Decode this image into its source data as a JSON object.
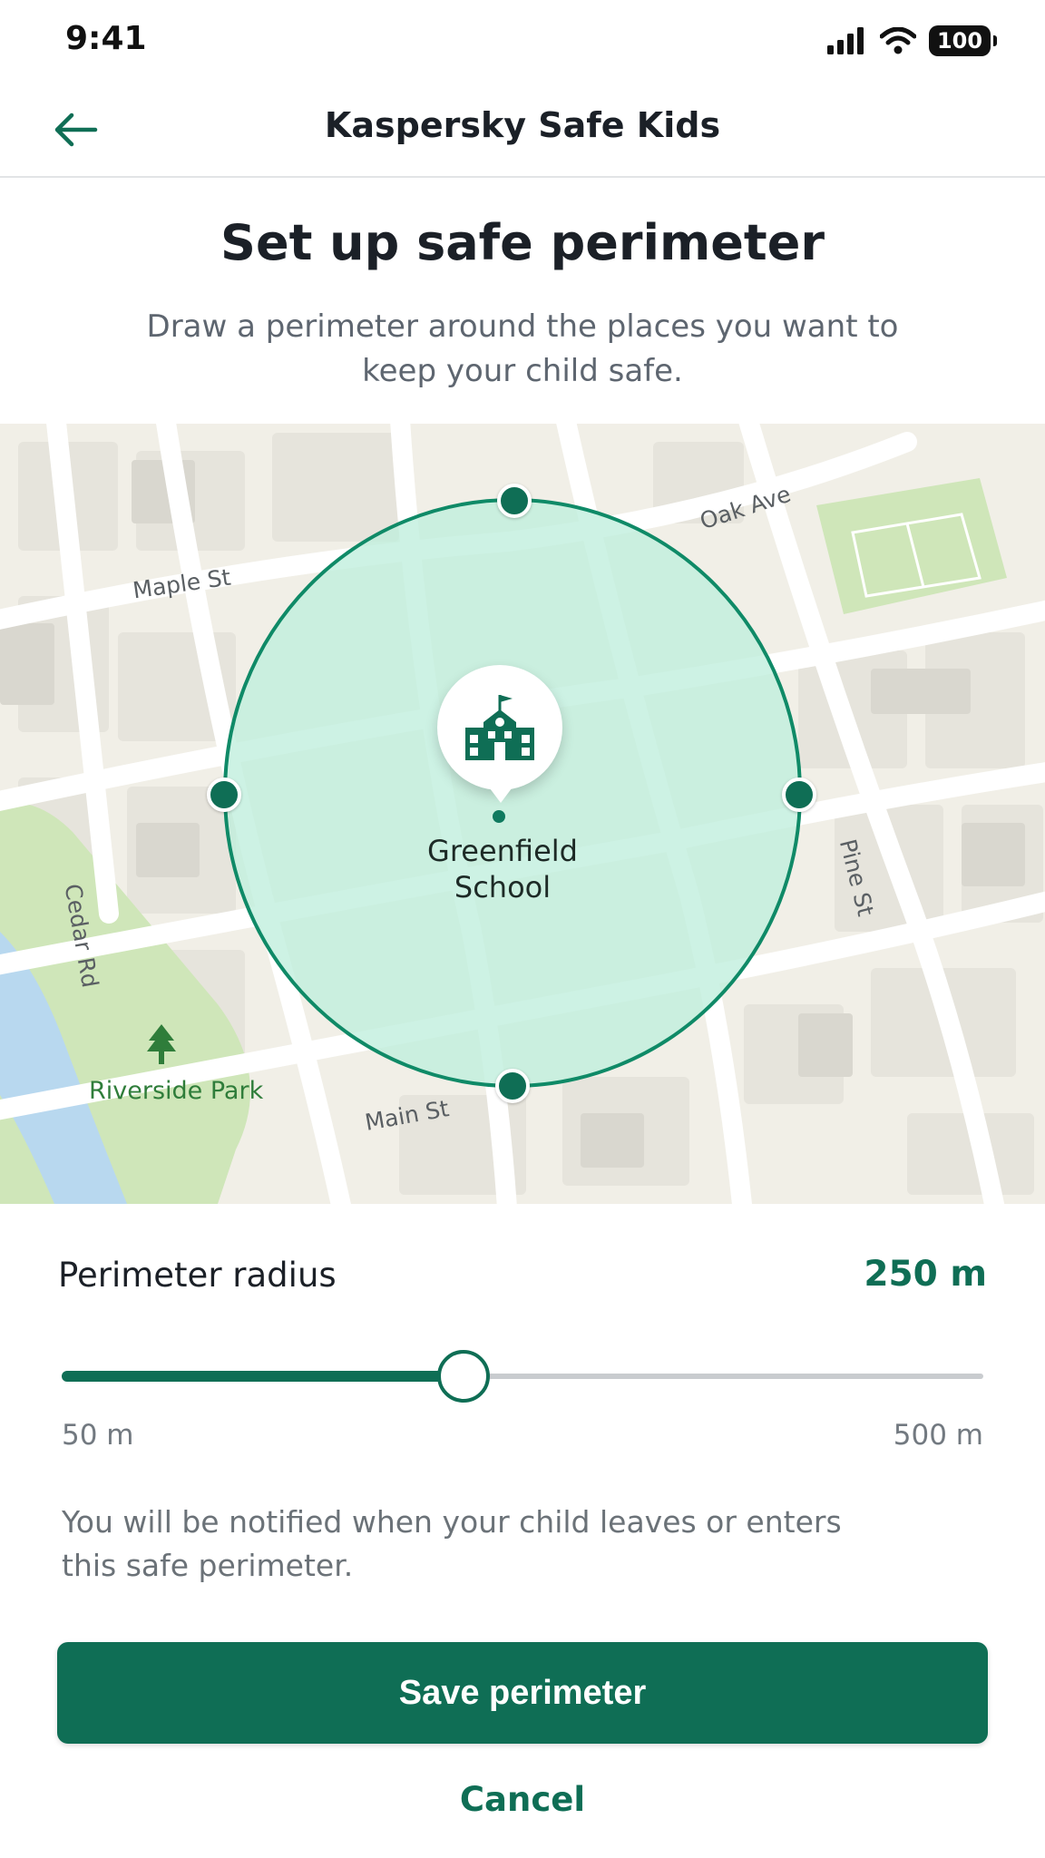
{
  "status_bar": {
    "time": "9:41",
    "battery": "100",
    "icons": [
      "signal-icon",
      "wifi-icon",
      "battery-icon"
    ]
  },
  "nav": {
    "title": "Kaspersky Safe Kids",
    "back_icon": "arrow-left-icon"
  },
  "header": {
    "title": "Set up safe perimeter",
    "subtitle": "Draw a perimeter around the places you want to keep your child safe."
  },
  "map": {
    "place_name": "Greenfield School",
    "place_icon": "school-icon",
    "park_name": "Riverside Park",
    "park_icon": "tree-icon",
    "streets": [
      "Maple St",
      "Oak Ave",
      "Cedar Rd",
      "Pine St",
      "Main St"
    ]
  },
  "radius": {
    "label": "Perimeter radius",
    "value_text": "250 m",
    "min_label": "50 m",
    "max_label": "500 m",
    "min": 50,
    "max": 500,
    "value": 250
  },
  "notice": "You will be notified when your child leaves or enters this safe perimeter.",
  "actions": {
    "save_label": "Save perimeter",
    "cancel_label": "Cancel"
  },
  "colors": {
    "accent": "#0f6e55",
    "perimeter_fill": "#bfeedd",
    "park": "#cfe6b9",
    "water": "#b8d8ef"
  }
}
